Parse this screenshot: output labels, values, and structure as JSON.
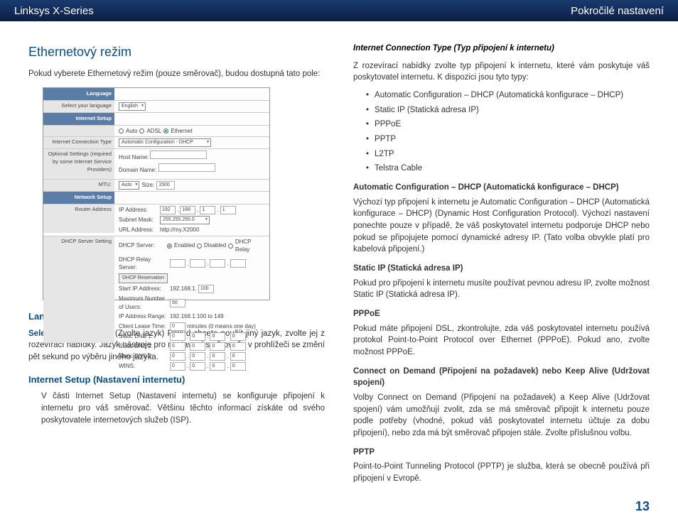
{
  "header": {
    "left": "Linksys X-Series",
    "right": "Pokročilé nastavení"
  },
  "left": {
    "h2": "Ethernetový režim",
    "intro": "Pokud vyberete Ethernetový režim (pouze směrovač), budou dostupná tato pole:",
    "lang_h": "Language (Jazyk)",
    "lang_bold": "Select your language",
    "lang_rest": " (Zvolte jazyk)  Pokud chcete použít jiný jazyk, zvolte jej z rozevírací nabídky. Jazyk nástroje pro nastavení směrovače v prohlížeči se změní pět sekund po výběru jiného jazyka.",
    "isetup_h": "Internet Setup (Nastavení internetu)",
    "isetup_p": "V části Internet Setup (Nastavení internetu) se konfiguruje připojení k internetu pro váš směrovač. Většinu těchto informací získáte od svého poskytovatele internetových služeb (ISP)."
  },
  "ss": {
    "lang_hdr": "Language",
    "sel_lang": "Select your language",
    "english": "English",
    "isetup_hdr": "Internet Setup",
    "modes": {
      "auto": "Auto",
      "adsl": "ADSL",
      "eth": "Ethernet"
    },
    "ict_lbl": "Internet Connection Type",
    "ict_val": "Automatic Configuration - DHCP",
    "opt_lbl": "Optional Settings (required by some Internet Service Providers)",
    "host": "Host Name:",
    "domain": "Domain Name:",
    "mtu": "MTU:",
    "mtu_val": "Auto",
    "size": "Size:",
    "size_val": "1500",
    "nsetup_hdr": "Network Setup",
    "router_addr": "Router Address",
    "ip_lbl": "IP Address:",
    "ip": [
      "192",
      "168",
      "1",
      "1"
    ],
    "subnet_lbl": "Subnet Mask:",
    "subnet": "255.255.255.0",
    "url_lbl": "URL Address:",
    "url": "http://my.X2000",
    "dhcp_hdr": "DHCP Server Setting",
    "dhcp_srv": "DHCP Server:",
    "enabled": "Enabled",
    "disabled": "Disabled",
    "relay": "DHCP Relay",
    "dhcp_relay_srv": "DHCP Relay Server:",
    "dhcp_res": "DHCP Reservation",
    "start_ip": "Start IP Address:",
    "start_ip_pre": "192.168.1.",
    "start_ip_val": "100",
    "max_users": "Maximum Number of Users:",
    "max_users_val": "50",
    "ip_range": "IP Address Range:",
    "ip_range_val": "192.168.1.100 to 149",
    "lease": "Client Lease Time:",
    "lease_val": "0",
    "lease_note": "minutes (0 means one day)",
    "dns1": "Static DNS 1:",
    "dns2": "Static DNS 2:",
    "dns3": "Static DNS 3:",
    "wins": "WINS:",
    "zero": "0"
  },
  "right": {
    "h4": "Internet Connection Type (Typ připojení k internetu)",
    "p1": "Z rozevírací nabídky zvolte typ připojení k internetu, které vám poskytuje váš poskytovatel internetu. K dispozici jsou tyto typy:",
    "types": [
      "Automatic Configuration – DHCP (Automatická konfigurace – DHCP)",
      "Static IP (Statická adresa IP)",
      "PPPoE",
      "PPTP",
      "L2TP",
      "Telstra Cable"
    ],
    "dhcp_h": "Automatic Configuration – DHCP (Automatická konfigurace – DHCP)",
    "dhcp_p": "Výchozí typ připojení k internetu je Automatic Configuration – DHCP (Automatická konfigurace – DHCP) (Dynamic Host Configuration Protocol). Výchozí nastavení ponechte pouze v případě, že váš poskytovatel internetu podporuje DHCP nebo pokud se připojujete pomocí dynamické adresy IP. (Tato volba obvykle platí pro kabelová připojení.)",
    "static_h": "Static IP (Statická adresa IP)",
    "static_p": "Pokud pro připojení k internetu musíte používat pevnou adresu IP, zvolte možnost Static IP (Statická adresa IP).",
    "pppoe_h": "PPPoE",
    "pppoe_p": "Pokud máte připojení DSL, zkontrolujte, zda váš poskytovatel internetu používá protokol Point-to-Point Protocol over Ethernet (PPPoE). Pokud ano, zvolte možnost PPPoE.",
    "cod_h": "Connect on Demand (Připojení na požadavek) nebo Keep Alive (Udržovat spojení)",
    "cod_p": "Volby Connect on Demand (Připojení na požadavek) a Keep Alive (Udržovat spojení) vám umožňují zvolit, zda se má směrovač připojit k internetu pouze podle potřeby (vhodné, pokud váš poskytovatel internetu účtuje za dobu připojení), nebo zda má být směrovač připojen stále. Zvolte příslušnou volbu.",
    "pptp_h": "PPTP",
    "pptp_p": "Point-to-Point Tunneling Protocol (PPTP) je služba, která se obecně používá při připojení v Evropě."
  },
  "page": "13"
}
